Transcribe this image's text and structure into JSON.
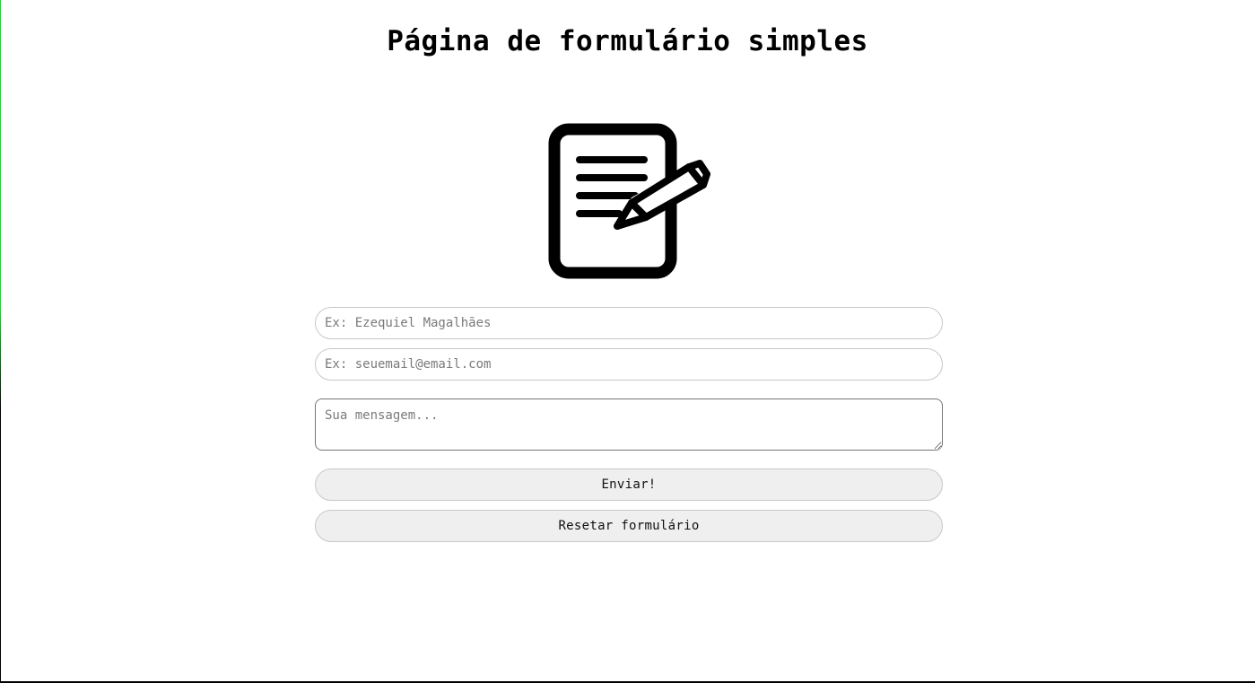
{
  "page": {
    "title": "Página de formulário simples"
  },
  "form": {
    "icon": "document-with-pencil-icon",
    "name_placeholder": "Ex: Ezequiel Magalhães",
    "email_placeholder": "Ex: seuemail@email.com",
    "message_placeholder": "Sua mensagem...",
    "submit_label": "Enviar!",
    "reset_label": "Resetar formulário"
  },
  "colors": {
    "background": "#ffffff",
    "input_border": "#c8c8c8",
    "button_background": "#efefef",
    "frame_accent": "#2ecc40"
  }
}
